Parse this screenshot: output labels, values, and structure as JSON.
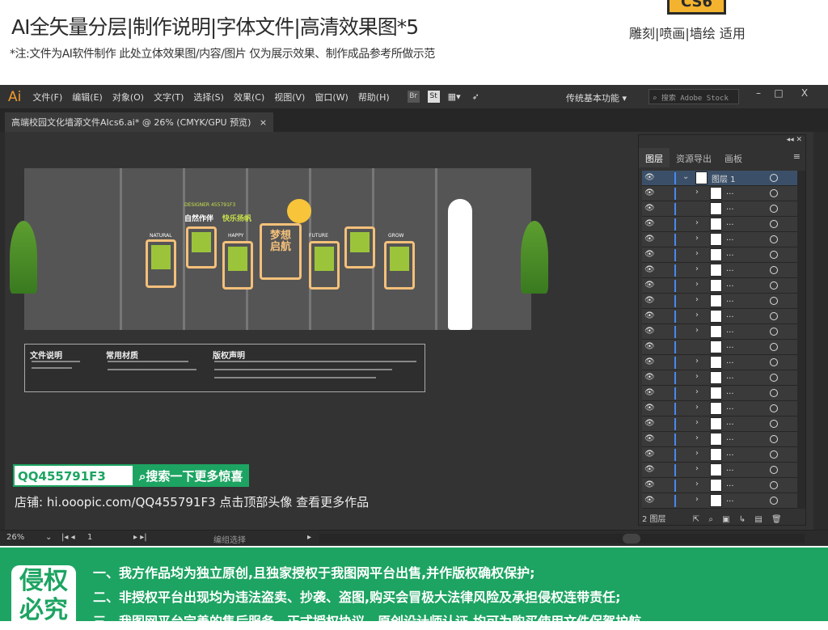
{
  "header": {
    "title": "AI全矢量分层|制作说明|字体文件|高清效果图*5",
    "subtitle": "*注:文件为AI软件制作 此处立体效果图/内容/图片 仅为展示效果、制作成品参考所做示范",
    "version_badge": "CS6",
    "uses": "雕刻|喷画|墙绘 适用"
  },
  "app": {
    "logo": "Ai",
    "menu": [
      "文件(F)",
      "编辑(E)",
      "对象(O)",
      "文字(T)",
      "选择(S)",
      "效果(C)",
      "视图(V)",
      "窗口(W)",
      "帮助(H)"
    ],
    "toolbar_icons": [
      "Br",
      "St"
    ],
    "workspace": "传统基本功能",
    "search_placeholder": "搜索 Adobe Stock",
    "window_buttons": [
      "–",
      "□",
      "X"
    ]
  },
  "document_tab": {
    "title": "高端校园文化墙源文件AIcs6.ai* @ 26% (CMYK/GPU 预览)",
    "close": "×"
  },
  "artwork": {
    "designer": "DESIGNER 455791F3",
    "slogan_left": "自然作伴",
    "slogan_right": "快乐扬帆",
    "center_title": "梦想启航",
    "labels": [
      "NATURAL",
      "HAPPY",
      "FUTURE",
      "GROW"
    ]
  },
  "info_box": {
    "sections": [
      "文件说明",
      "常用材质",
      "版权声明"
    ]
  },
  "promo": {
    "qq": "QQ455791F3",
    "search_button": "搜索一下更多惊喜",
    "shop": "店铺: hi.ooopic.com/QQ455791F3  点击顶部头像 查看更多作品"
  },
  "layers_panel": {
    "tabs": [
      "图层",
      "资源导出",
      "画板"
    ],
    "top_layer": "图层 1",
    "sublayer_label": "...",
    "layer_count": "2 图层",
    "accent": "#4a88f0"
  },
  "status_bar": {
    "zoom": "26%",
    "artboard": "1",
    "tool": "编组选择"
  },
  "footer": {
    "badge": "侵权必究",
    "lines": [
      "一、我方作品均为独立原创,且独家授权于我图网平台出售,并作版权确权保护;",
      "二、非授权平台出现均为违法盗卖、抄袭、盗图,购买会冒极大法律风险及承担侵权连带责任;",
      "三、我图网平台完善的售后服务、正式授权协议、原创设计师认证,均可为购买使用文件保驾护航。"
    ],
    "color": "#1da462"
  }
}
